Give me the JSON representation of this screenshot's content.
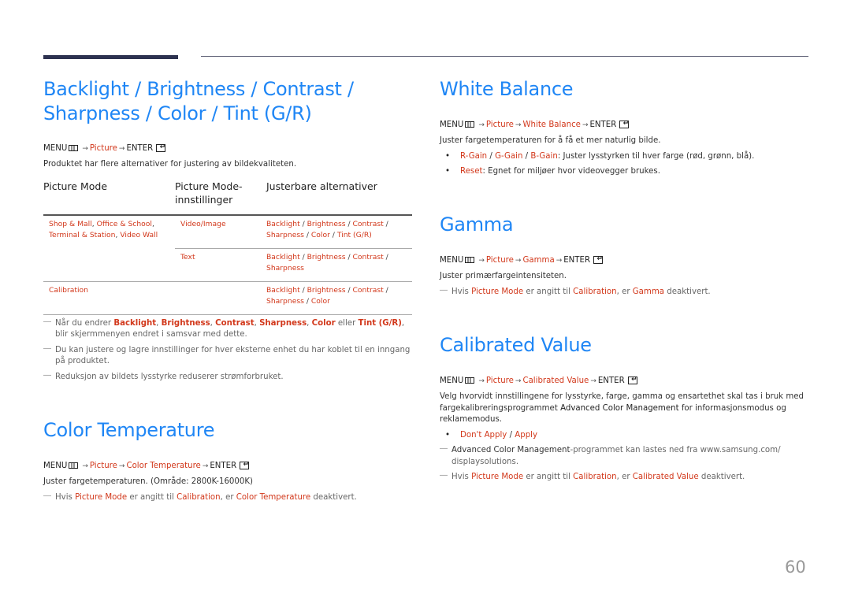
{
  "page": {
    "number": "60"
  },
  "menu_common": {
    "menu": "MENU",
    "picture": "Picture",
    "enter": "ENTER",
    "arrow": "→"
  },
  "sections": {
    "backlight": {
      "title_line1": "Backlight / Brightness / Contrast /",
      "title_line2": "Sharpness / Color / Tint (G/R)",
      "description": "Produktet har flere alternativer for justering av bildekvaliteten.",
      "table": {
        "headers": [
          "Picture Mode",
          "Picture Mode-innstillinger",
          "Justerbare alternativer"
        ],
        "header_2_line1": "Picture Mode-",
        "header_2_line2": "innstillinger",
        "rows": [
          {
            "mode": "Shop & Mall, Office & School, Terminal & Station, Video Wall",
            "mode_parts": [
              "Shop & Mall",
              "Office & School",
              "Terminal & Station",
              "Video Wall"
            ],
            "setting": "Video/Image",
            "options": [
              "Backlight",
              "Brightness",
              "Contrast",
              "Sharpness",
              "Color",
              "Tint (G/R)"
            ]
          },
          {
            "mode": "",
            "setting": "Text",
            "options": [
              "Backlight",
              "Brightness",
              "Contrast",
              "Sharpness"
            ]
          },
          {
            "mode": "Calibration",
            "setting": "",
            "options": [
              "Backlight",
              "Brightness",
              "Contrast",
              "Sharpness",
              "Color"
            ]
          }
        ]
      },
      "notes": [
        {
          "prefix": "Når du endrer ",
          "terms": [
            "Backlight",
            "Brightness",
            "Contrast",
            "Sharpness",
            "Color",
            "Tint (G/R)"
          ],
          "connector": "eller",
          "suffix": ", blir skjermmenyen endret i samsvar med dette."
        },
        {
          "text": "Du kan justere og lagre innstillinger for hver eksterne enhet du har koblet til en inngang på produktet."
        },
        {
          "text": "Reduksjon av bildets lysstyrke reduserer strømforbruket."
        }
      ]
    },
    "color_temperature": {
      "title": "Color Temperature",
      "menu_item": "Color Temperature",
      "description": "Juster fargetemperaturen. (Område: 2800K-16000K)",
      "note": {
        "p1": "Hvis ",
        "t1": "Picture Mode",
        "p2": " er angitt til ",
        "t2": "Calibration",
        "p3": ", er ",
        "t3": "Color Temperature",
        "p4": " deaktivert."
      }
    },
    "white_balance": {
      "title": "White Balance",
      "menu_item": "White Balance",
      "description": "Juster fargetemperaturen for å få et mer naturlig bilde.",
      "bullets": [
        {
          "terms": [
            "R-Gain",
            "G-Gain",
            "B-Gain"
          ],
          "text": ": Juster lysstyrken til hver farge (rød, grønn, blå)."
        },
        {
          "terms": [
            "Reset"
          ],
          "text": ": Egnet for miljøer hvor videovegger brukes."
        }
      ]
    },
    "gamma": {
      "title": "Gamma",
      "menu_item": "Gamma",
      "description": "Juster primærfargeintensiteten.",
      "note": {
        "p1": "Hvis ",
        "t1": "Picture Mode",
        "p2": " er angitt til ",
        "t2": "Calibration",
        "p3": ", er ",
        "t3": "Gamma",
        "p4": " deaktivert."
      }
    },
    "calibrated_value": {
      "title": "Calibrated Value",
      "menu_item": "Calibrated Value",
      "description_p1": "Velg hvorvidt innstillingene for lysstyrke, farge, gamma og ensartethet skal tas i bruk med fargekalibreringsprogrammet ",
      "description_term": "Advanced Color Management",
      "description_p2": " for informasjonsmodus og reklamemodus.",
      "bullets": [
        {
          "terms": [
            "Don't Apply",
            "Apply"
          ]
        }
      ],
      "note1": {
        "term": "Advanced Color Management",
        "text": "-programmet kan lastes ned fra www.samsung.com/ displaysolutions."
      },
      "note2": {
        "p1": "Hvis ",
        "t1": "Picture Mode",
        "p2": " er angitt til ",
        "t2": "Calibration",
        "p3": ", er ",
        "t3": "Calibrated Value",
        "p4": " deaktivert."
      }
    }
  }
}
